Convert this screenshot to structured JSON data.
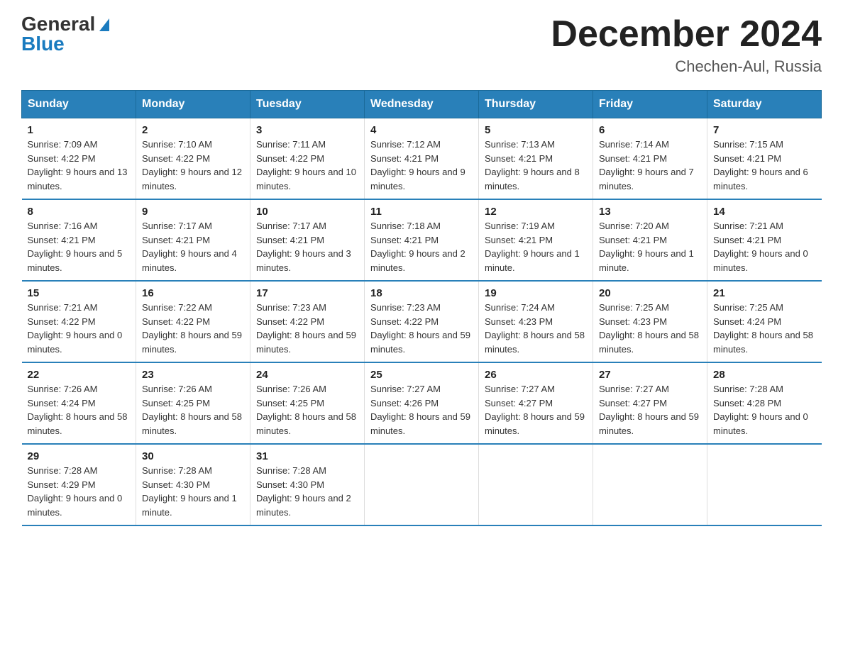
{
  "header": {
    "logo_general": "General",
    "logo_blue": "Blue",
    "month_title": "December 2024",
    "subtitle": "Chechen-Aul, Russia"
  },
  "days_of_week": [
    "Sunday",
    "Monday",
    "Tuesday",
    "Wednesday",
    "Thursday",
    "Friday",
    "Saturday"
  ],
  "weeks": [
    [
      {
        "day": "1",
        "sunrise": "7:09 AM",
        "sunset": "4:22 PM",
        "daylight": "9 hours and 13 minutes."
      },
      {
        "day": "2",
        "sunrise": "7:10 AM",
        "sunset": "4:22 PM",
        "daylight": "9 hours and 12 minutes."
      },
      {
        "day": "3",
        "sunrise": "7:11 AM",
        "sunset": "4:22 PM",
        "daylight": "9 hours and 10 minutes."
      },
      {
        "day": "4",
        "sunrise": "7:12 AM",
        "sunset": "4:21 PM",
        "daylight": "9 hours and 9 minutes."
      },
      {
        "day": "5",
        "sunrise": "7:13 AM",
        "sunset": "4:21 PM",
        "daylight": "9 hours and 8 minutes."
      },
      {
        "day": "6",
        "sunrise": "7:14 AM",
        "sunset": "4:21 PM",
        "daylight": "9 hours and 7 minutes."
      },
      {
        "day": "7",
        "sunrise": "7:15 AM",
        "sunset": "4:21 PM",
        "daylight": "9 hours and 6 minutes."
      }
    ],
    [
      {
        "day": "8",
        "sunrise": "7:16 AM",
        "sunset": "4:21 PM",
        "daylight": "9 hours and 5 minutes."
      },
      {
        "day": "9",
        "sunrise": "7:17 AM",
        "sunset": "4:21 PM",
        "daylight": "9 hours and 4 minutes."
      },
      {
        "day": "10",
        "sunrise": "7:17 AM",
        "sunset": "4:21 PM",
        "daylight": "9 hours and 3 minutes."
      },
      {
        "day": "11",
        "sunrise": "7:18 AM",
        "sunset": "4:21 PM",
        "daylight": "9 hours and 2 minutes."
      },
      {
        "day": "12",
        "sunrise": "7:19 AM",
        "sunset": "4:21 PM",
        "daylight": "9 hours and 1 minute."
      },
      {
        "day": "13",
        "sunrise": "7:20 AM",
        "sunset": "4:21 PM",
        "daylight": "9 hours and 1 minute."
      },
      {
        "day": "14",
        "sunrise": "7:21 AM",
        "sunset": "4:21 PM",
        "daylight": "9 hours and 0 minutes."
      }
    ],
    [
      {
        "day": "15",
        "sunrise": "7:21 AM",
        "sunset": "4:22 PM",
        "daylight": "9 hours and 0 minutes."
      },
      {
        "day": "16",
        "sunrise": "7:22 AM",
        "sunset": "4:22 PM",
        "daylight": "8 hours and 59 minutes."
      },
      {
        "day": "17",
        "sunrise": "7:23 AM",
        "sunset": "4:22 PM",
        "daylight": "8 hours and 59 minutes."
      },
      {
        "day": "18",
        "sunrise": "7:23 AM",
        "sunset": "4:22 PM",
        "daylight": "8 hours and 59 minutes."
      },
      {
        "day": "19",
        "sunrise": "7:24 AM",
        "sunset": "4:23 PM",
        "daylight": "8 hours and 58 minutes."
      },
      {
        "day": "20",
        "sunrise": "7:25 AM",
        "sunset": "4:23 PM",
        "daylight": "8 hours and 58 minutes."
      },
      {
        "day": "21",
        "sunrise": "7:25 AM",
        "sunset": "4:24 PM",
        "daylight": "8 hours and 58 minutes."
      }
    ],
    [
      {
        "day": "22",
        "sunrise": "7:26 AM",
        "sunset": "4:24 PM",
        "daylight": "8 hours and 58 minutes."
      },
      {
        "day": "23",
        "sunrise": "7:26 AM",
        "sunset": "4:25 PM",
        "daylight": "8 hours and 58 minutes."
      },
      {
        "day": "24",
        "sunrise": "7:26 AM",
        "sunset": "4:25 PM",
        "daylight": "8 hours and 58 minutes."
      },
      {
        "day": "25",
        "sunrise": "7:27 AM",
        "sunset": "4:26 PM",
        "daylight": "8 hours and 59 minutes."
      },
      {
        "day": "26",
        "sunrise": "7:27 AM",
        "sunset": "4:27 PM",
        "daylight": "8 hours and 59 minutes."
      },
      {
        "day": "27",
        "sunrise": "7:27 AM",
        "sunset": "4:27 PM",
        "daylight": "8 hours and 59 minutes."
      },
      {
        "day": "28",
        "sunrise": "7:28 AM",
        "sunset": "4:28 PM",
        "daylight": "9 hours and 0 minutes."
      }
    ],
    [
      {
        "day": "29",
        "sunrise": "7:28 AM",
        "sunset": "4:29 PM",
        "daylight": "9 hours and 0 minutes."
      },
      {
        "day": "30",
        "sunrise": "7:28 AM",
        "sunset": "4:30 PM",
        "daylight": "9 hours and 1 minute."
      },
      {
        "day": "31",
        "sunrise": "7:28 AM",
        "sunset": "4:30 PM",
        "daylight": "9 hours and 2 minutes."
      },
      {
        "day": "",
        "sunrise": "",
        "sunset": "",
        "daylight": ""
      },
      {
        "day": "",
        "sunrise": "",
        "sunset": "",
        "daylight": ""
      },
      {
        "day": "",
        "sunrise": "",
        "sunset": "",
        "daylight": ""
      },
      {
        "day": "",
        "sunrise": "",
        "sunset": "",
        "daylight": ""
      }
    ]
  ],
  "labels": {
    "sunrise": "Sunrise:",
    "sunset": "Sunset:",
    "daylight": "Daylight:"
  }
}
